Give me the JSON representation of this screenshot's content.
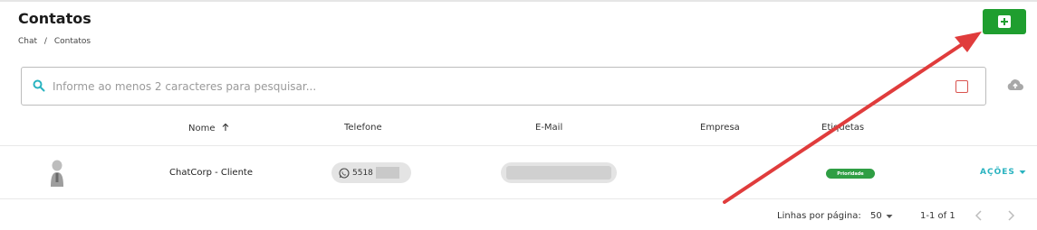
{
  "page": {
    "title": "Contatos"
  },
  "breadcrumb": {
    "items": [
      "Chat",
      "/",
      "Contatos"
    ]
  },
  "search": {
    "placeholder": "Informe ao menos 2 caracteres para pesquisar...",
    "value": ""
  },
  "table": {
    "columns": [
      "Nome",
      "Telefone",
      "E-Mail",
      "Empresa",
      "Etiquetas"
    ],
    "rows": [
      {
        "name": "ChatCorp - Cliente",
        "phone_visible": "5518",
        "company": "",
        "tag": "Prioridade",
        "actions_label": "AÇÕES"
      }
    ]
  },
  "pagination": {
    "rows_per_page_label": "Linhas por página:",
    "rows_per_page": "50",
    "range": "1-1 of 1"
  },
  "colors": {
    "accent_green": "#1f9e2f",
    "tag_green": "#2f9e44",
    "actions_teal": "#2ab3c0",
    "arrow_red": "#e03c3c",
    "checkbox_red": "#d9534f"
  },
  "icons": [
    "plus-square-icon",
    "search-icon",
    "cloud-upload-icon",
    "sort-arrow-up-icon",
    "whatsapp-icon",
    "chevron-down-icon",
    "chevron-left-icon",
    "chevron-right-icon",
    "avatar-icon"
  ]
}
